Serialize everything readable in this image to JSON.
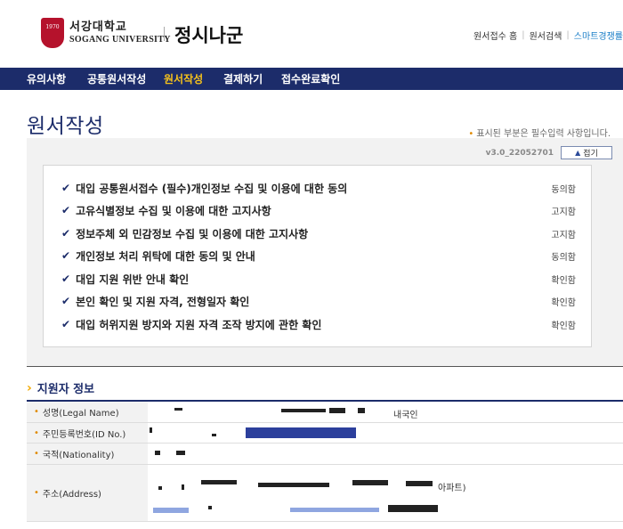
{
  "header": {
    "logo_mark": "1970",
    "logo_korean": "서강대학교",
    "logo_english": "SOGANG UNIVERSITY",
    "site_title": "정시나군",
    "top_links": [
      "원서접수 홈",
      "원서검색",
      "스마트경쟁률"
    ]
  },
  "nav": {
    "items": [
      "유의사항",
      "공통원서작성",
      "원서작성",
      "결제하기",
      "접수완료확인"
    ],
    "active_index": 2
  },
  "page": {
    "title": "원서작성",
    "required_note": "표시된 부분은 필수입력 사항입니다."
  },
  "consent": {
    "version": "v3.0_22052701",
    "fold_label": "접기",
    "items": [
      {
        "label": "대입 공통원서접수 (필수)개인정보 수집 및 이용에 대한 동의",
        "status": "동의함"
      },
      {
        "label": "고유식별정보 수집 및 이용에 대한 고지사항",
        "status": "고지함"
      },
      {
        "label": "정보주체 외 민감정보 수집 및 이용에 대한 고지사항",
        "status": "고지함"
      },
      {
        "label": "개인정보 처리 위탁에 대한 동의 및 안내",
        "status": "동의함"
      },
      {
        "label": "대입 지원 위반 안내 확인",
        "status": "확인함"
      },
      {
        "label": "본인 확인 및 지원 자격, 전형일자 확인",
        "status": "확인함"
      },
      {
        "label": "대입 허위지원 방지와 지원 자격 조작 방지에 관한 확인",
        "status": "확인함"
      }
    ]
  },
  "applicant": {
    "section_title": "지원자 정보",
    "fields": [
      {
        "label": "성명(Legal Name)",
        "value": "내국인"
      },
      {
        "label": "주민등록번호(ID No.)",
        "value": ""
      },
      {
        "label": "국적(Nationality)",
        "value": ""
      },
      {
        "label": "주소(Address)",
        "value": "아파트)"
      }
    ]
  },
  "colors": {
    "nav_bg": "#1c2c6a",
    "nav_active": "#f6c21b",
    "accent_orange": "#e08a00",
    "brand_red": "#b5122c"
  }
}
